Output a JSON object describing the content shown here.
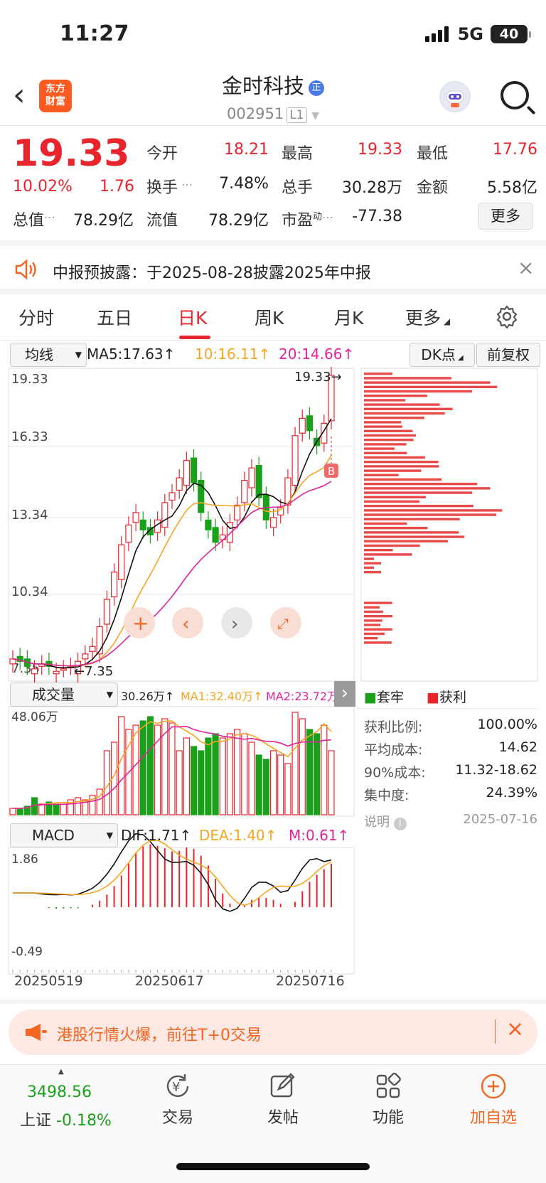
{
  "status": {
    "time": "11:27",
    "network": "5G",
    "battery": "40"
  },
  "header": {
    "logo_text": "东方\n财富",
    "logo_line1": "东方",
    "logo_line2": "财富",
    "stock_name": "金时科技",
    "stock_badge": "正",
    "code": "002951",
    "level": "L1"
  },
  "quote": {
    "price": "19.33",
    "pct": "10.02%",
    "change": "1.76",
    "fields": [
      {
        "label": "今开",
        "value": "18.21"
      },
      {
        "label": "最高",
        "value": "19.33"
      },
      {
        "label": "最低",
        "value": "17.76"
      },
      {
        "label": "换手",
        "value": "7.48%"
      },
      {
        "label": "总手",
        "value": "30.28万"
      },
      {
        "label": "金额",
        "value": "5.58亿"
      },
      {
        "label": "总值",
        "value": "78.29亿"
      },
      {
        "label": "流值",
        "value": "78.29亿"
      },
      {
        "label": "市盈",
        "value": "-77.38"
      }
    ],
    "pe_super": "动",
    "more": "更多"
  },
  "notice": {
    "text": "中报预披露：于2025-08-28披露2025年中报"
  },
  "tabs": [
    "分时",
    "五日",
    "日K",
    "周K",
    "月K",
    "更多"
  ],
  "active_tab": "日K",
  "kline": {
    "indicator": "均线",
    "ma5": "MA5:17.63",
    "ma10": "10:16.11",
    "ma20": "20:14.66",
    "dk_button": "DK点",
    "adjust_button": "前复权",
    "y_labels": [
      "19.33",
      "16.33",
      "13.34",
      "10.34",
      "7.35"
    ],
    "high_marker": "19.33",
    "low_marker": "7.35",
    "b_marker": "B"
  },
  "volume": {
    "indicator": "成交量",
    "value": "30.26万",
    "ma1": "MA1:32.40万",
    "ma2": "MA2:23.72万",
    "max_label": "48.06万"
  },
  "macd": {
    "indicator": "MACD",
    "dif": "DIF:1.71",
    "dea": "DEA:1.40",
    "m": "M:0.61",
    "y_top": "1.86",
    "y_bottom": "-0.49"
  },
  "dates": [
    "20250519",
    "20250617",
    "20250716"
  ],
  "chip": {
    "legend_trapped": "套牢",
    "legend_profit": "获利",
    "stats": [
      {
        "label": "获利比例:",
        "value": "100.00%"
      },
      {
        "label": "平均成本:",
        "value": "14.62"
      },
      {
        "label": "90%成本:",
        "value": "11.32-18.62"
      },
      {
        "label": "集中度:",
        "value": "24.39%"
      }
    ],
    "note_label": "说明",
    "note_date": "2025-07-16"
  },
  "banner": {
    "text": "港股行情火爆，前往T+0交易"
  },
  "bottom_nav": {
    "index_value": "3498.56",
    "index_name": "上证",
    "index_pct": "-0.18%",
    "items": [
      "交易",
      "发帖",
      "功能",
      "加自选"
    ]
  },
  "colors": {
    "up": "#e8242c",
    "down": "#1aa01a",
    "ma5": "#111111",
    "ma10": "#f5a623",
    "ma20": "#e0249a"
  }
}
